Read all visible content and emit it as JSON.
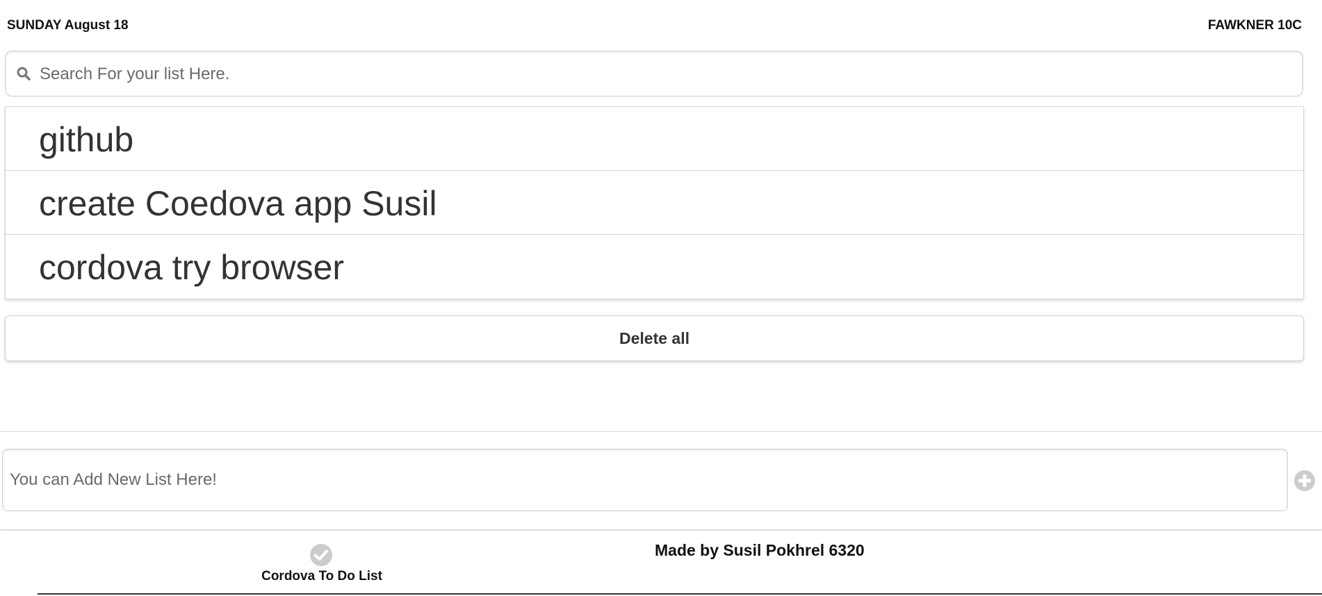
{
  "header": {
    "date": "SUNDAY August 18",
    "weather": "FAWKNER 10C"
  },
  "search": {
    "placeholder": "Search For your list Here.",
    "value": ""
  },
  "list": {
    "items": [
      {
        "label": "github"
      },
      {
        "label": "create Coedova app Susil"
      },
      {
        "label": "cordova try browser"
      }
    ]
  },
  "actions": {
    "delete_all_label": "Delete all"
  },
  "add_form": {
    "placeholder": "You can Add New List Here!",
    "value": "",
    "add_icon": "plus-circle-icon"
  },
  "footer": {
    "tab_label": "Cordova To Do List",
    "tab_icon": "check-circle-icon",
    "credit": "Made by Susil Pokhrel 6320"
  },
  "colors": {
    "text": "#333333",
    "border": "#d6d6d6",
    "icon_gray": "#cccccc"
  }
}
